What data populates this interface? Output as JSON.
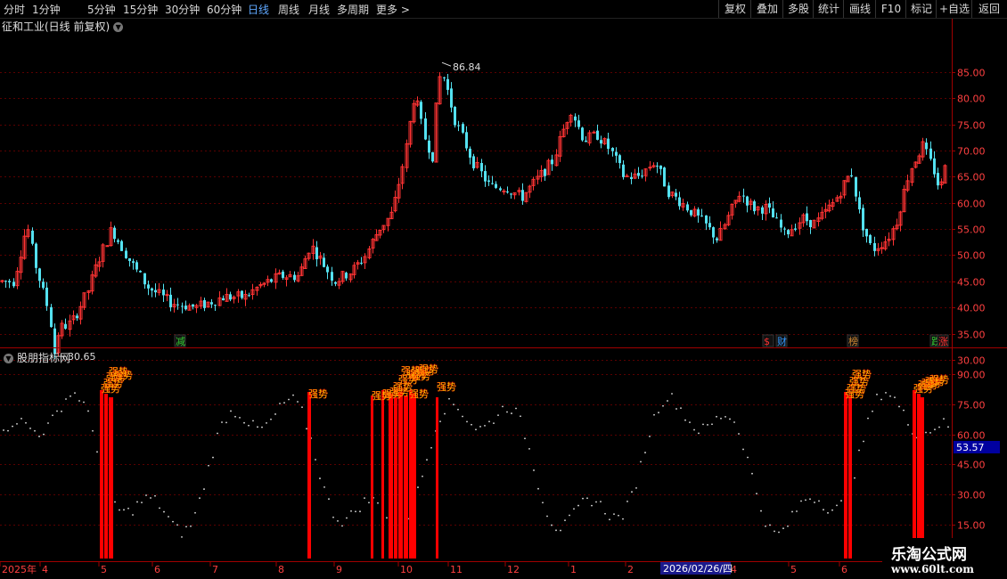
{
  "toolbar": {
    "periods": [
      "分时",
      "1分钟",
      "5分钟",
      "15分钟",
      "30分钟",
      "60分钟",
      "日线",
      "周线",
      "月线",
      "多周期",
      "更多 >"
    ],
    "active_period": "日线",
    "right_buttons": [
      "复权",
      "叠加",
      "多股",
      "统计",
      "画线",
      "F10",
      "标记",
      "+自选",
      "返回"
    ]
  },
  "main_panel": {
    "title": "征和工业(日线 前复权)",
    "price_ticks": [
      "85.00",
      "80.00",
      "75.00",
      "70.00",
      "65.00",
      "60.00",
      "55.00",
      "50.00",
      "45.00",
      "40.00",
      "35.00",
      "30.00"
    ],
    "high_label": "86.84",
    "low_label": "30.65",
    "markers": [
      {
        "text": "减",
        "color": "#33cc33"
      },
      {
        "text": "$",
        "color": "#ff3333"
      },
      {
        "text": "财",
        "color": "#3399ff"
      },
      {
        "text": "榜",
        "color": "#cc8833"
      },
      {
        "text": "跌",
        "color": "#33cc33"
      },
      {
        "text": "涨",
        "color": "#ff3333"
      }
    ],
    "up_color": "#ff3333",
    "down_color": "#54e1f0"
  },
  "indicator_panel": {
    "title": "股朋指标网",
    "ticks": [
      "90.00",
      "75.00",
      "60.00",
      "45.00",
      "30.00",
      "15.00"
    ],
    "current_value": "53.57",
    "signal_label": "强势",
    "bar_color": "#ff0000",
    "label_color": "#ffff00"
  },
  "xaxis": {
    "labels": [
      "2025年",
      "4",
      "5",
      "6",
      "7",
      "8",
      "9",
      "10",
      "11",
      "12",
      "1",
      "2",
      "4",
      "5",
      "6"
    ],
    "cursor_date": "2026/02/26/四"
  },
  "watermark": {
    "title": "乐淘公式网",
    "url": "www.60lt.com"
  }
}
